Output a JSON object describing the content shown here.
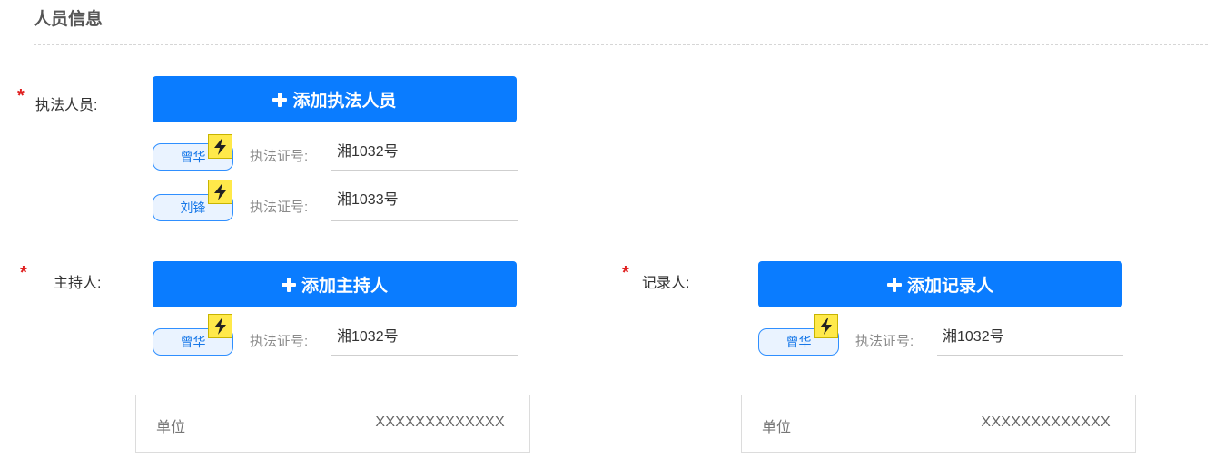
{
  "section": {
    "title": "人员信息"
  },
  "required_mark": "*",
  "enforcers": {
    "label": "执法人员:",
    "add_button": "添加执法人员",
    "people": [
      {
        "name": "曾华",
        "cert_label": "执法证号:",
        "cert_no": "湘1032号"
      },
      {
        "name": "刘锋",
        "cert_label": "执法证号:",
        "cert_no": "湘1033号"
      }
    ]
  },
  "host": {
    "label": "主持人:",
    "add_button": "添加主持人",
    "people": [
      {
        "name": "曾华",
        "cert_label": "执法证号:",
        "cert_no": "湘1032号"
      }
    ],
    "unit_label": "单位",
    "unit_value": "XXXXXXXXXXXXX"
  },
  "recorder": {
    "label": "记录人:",
    "add_button": "添加记录人",
    "people": [
      {
        "name": "曾华",
        "cert_label": "执法证号:",
        "cert_no": "湘1032号"
      }
    ],
    "unit_label": "单位",
    "unit_value": "XXXXXXXXXXXXX"
  },
  "icons": {
    "add": "plus-icon",
    "badge": "lightning-bolt-icon"
  },
  "colors": {
    "primary": "#0a7cff",
    "required": "#e02020",
    "badge": "#ffe94a",
    "tag_border": "#2f8fff"
  }
}
